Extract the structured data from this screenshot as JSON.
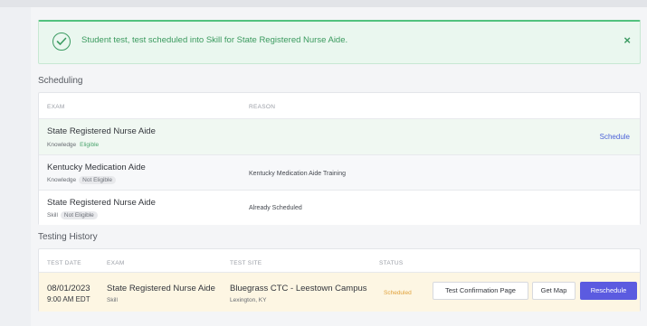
{
  "alert": {
    "message": "Student test, test scheduled into Skill for State Registered Nurse Aide.",
    "status_icon": "check-circle-icon",
    "close_icon": "close-icon",
    "close_glyph": "×"
  },
  "scheduling": {
    "title": "Scheduling",
    "columns": {
      "exam": "EXAM",
      "reason": "REASON"
    },
    "rows": [
      {
        "exam": "State Registered Nurse Aide",
        "type": "Knowledge",
        "eligibility": "Eligible",
        "reason": "",
        "action": "Schedule"
      },
      {
        "exam": "Kentucky Medication Aide",
        "type": "Knowledge",
        "eligibility": "Not Eligible",
        "reason": "Kentucky Medication Aide Training",
        "action": ""
      },
      {
        "exam": "State Registered Nurse Aide",
        "type": "Skill",
        "eligibility": "Not Eligible",
        "reason": "Already Scheduled",
        "action": ""
      }
    ]
  },
  "testing_history": {
    "title": "Testing History",
    "columns": {
      "test_date": "TEST DATE",
      "exam": "EXAM",
      "test_site": "TEST SITE",
      "status": "STATUS"
    },
    "rows": [
      {
        "date": "08/01/2023",
        "time": "9:00 AM EDT",
        "exam": "State Registered Nurse Aide",
        "exam_type": "Skill",
        "site": "Bluegrass CTC - Leestown Campus",
        "site_location": "Lexington, KY",
        "status": "Scheduled",
        "buttons": {
          "confirmation": "Test Confirmation Page",
          "map": "Get Map",
          "reschedule": "Reschedule"
        }
      }
    ]
  },
  "colors": {
    "success": "#3a9a5e",
    "link": "#4b62d8",
    "primary_button": "#5b5be0",
    "eligible_row_bg": "#f0f8f2",
    "scheduled_row_bg": "#fdf6e3",
    "status_scheduled": "#e0a13a"
  }
}
